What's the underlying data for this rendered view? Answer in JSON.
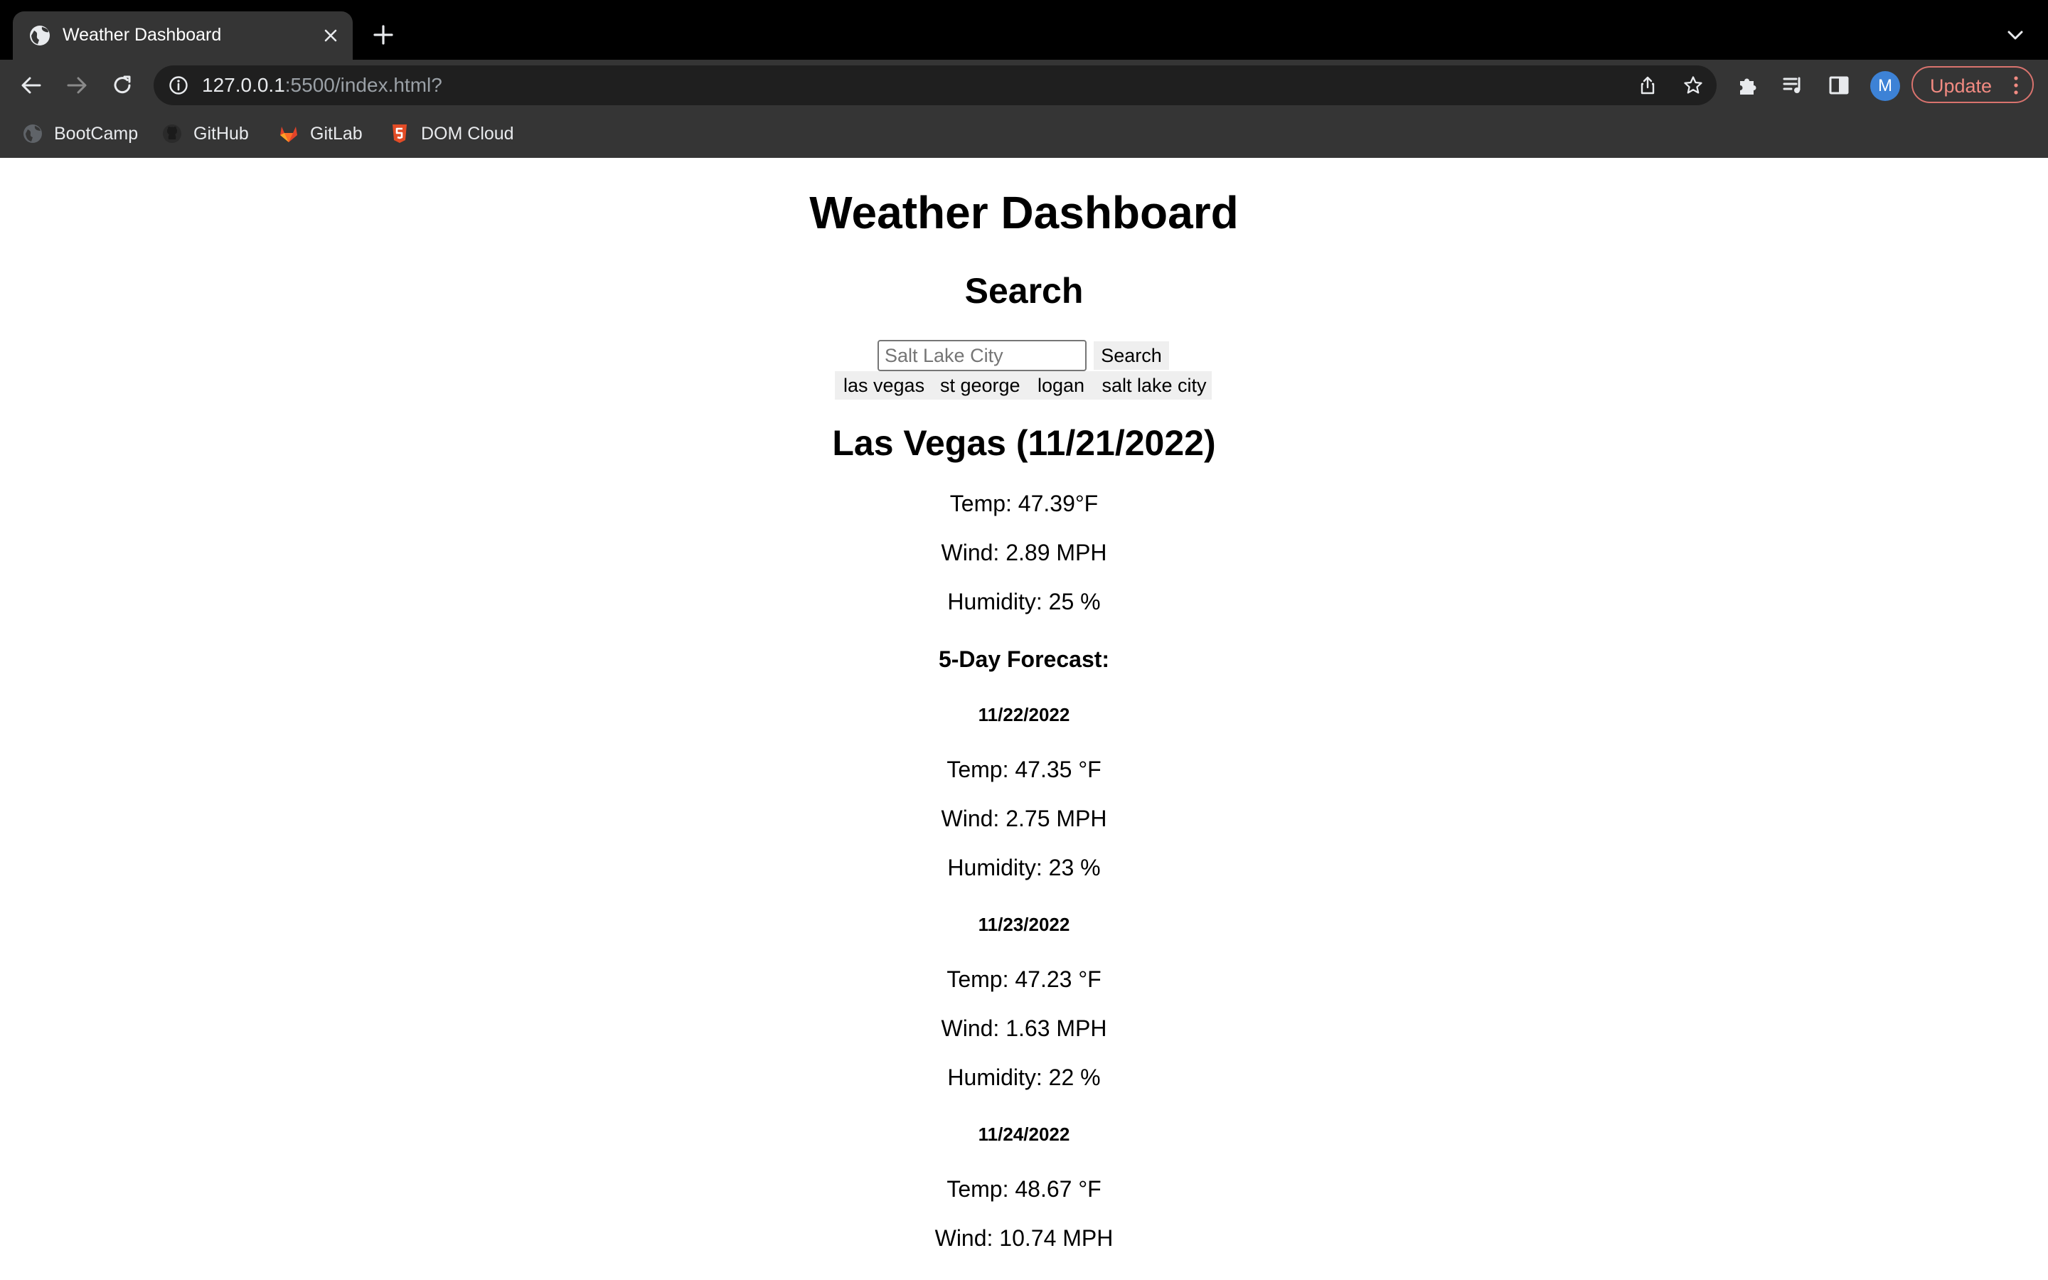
{
  "browser": {
    "tab_title": "Weather Dashboard",
    "url_host": "127.0.0.1",
    "url_rest": ":5500/index.html?",
    "bookmarks": [
      "BootCamp",
      "GitHub",
      "GitLab",
      "DOM Cloud"
    ],
    "avatar_initial": "M",
    "update_label": "Update"
  },
  "page": {
    "title": "Weather Dashboard",
    "search_heading": "Search",
    "search_placeholder": "Salt Lake City",
    "search_button": "Search",
    "history": [
      "las vegas",
      "st george",
      "logan",
      "salt lake city"
    ]
  },
  "current": {
    "heading": "Las Vegas (11/21/2022)",
    "temp": "Temp: 47.39°F",
    "wind": "Wind: 2.89 MPH",
    "humidity": "Humidity: 25 %"
  },
  "forecast": {
    "heading": "5-Day Forecast:",
    "days": [
      {
        "date": "11/22/2022",
        "temp": "Temp: 47.35 °F",
        "wind": "Wind: 2.75 MPH",
        "humidity": "Humidity: 23 %"
      },
      {
        "date": "11/23/2022",
        "temp": "Temp: 47.23 °F",
        "wind": "Wind: 1.63 MPH",
        "humidity": "Humidity: 22 %"
      },
      {
        "date": "11/24/2022",
        "temp": "Temp: 48.67 °F",
        "wind": "Wind: 10.74 MPH"
      }
    ]
  },
  "colors": {
    "chrome_dark": "#000000",
    "chrome_toolbar": "#353535",
    "omnibox": "#1f1f1f",
    "avatar": "#3d82d6",
    "update_accent": "#f28b82",
    "gitlab_orange": "#e24329",
    "domcloud_red": "#e34c26"
  }
}
